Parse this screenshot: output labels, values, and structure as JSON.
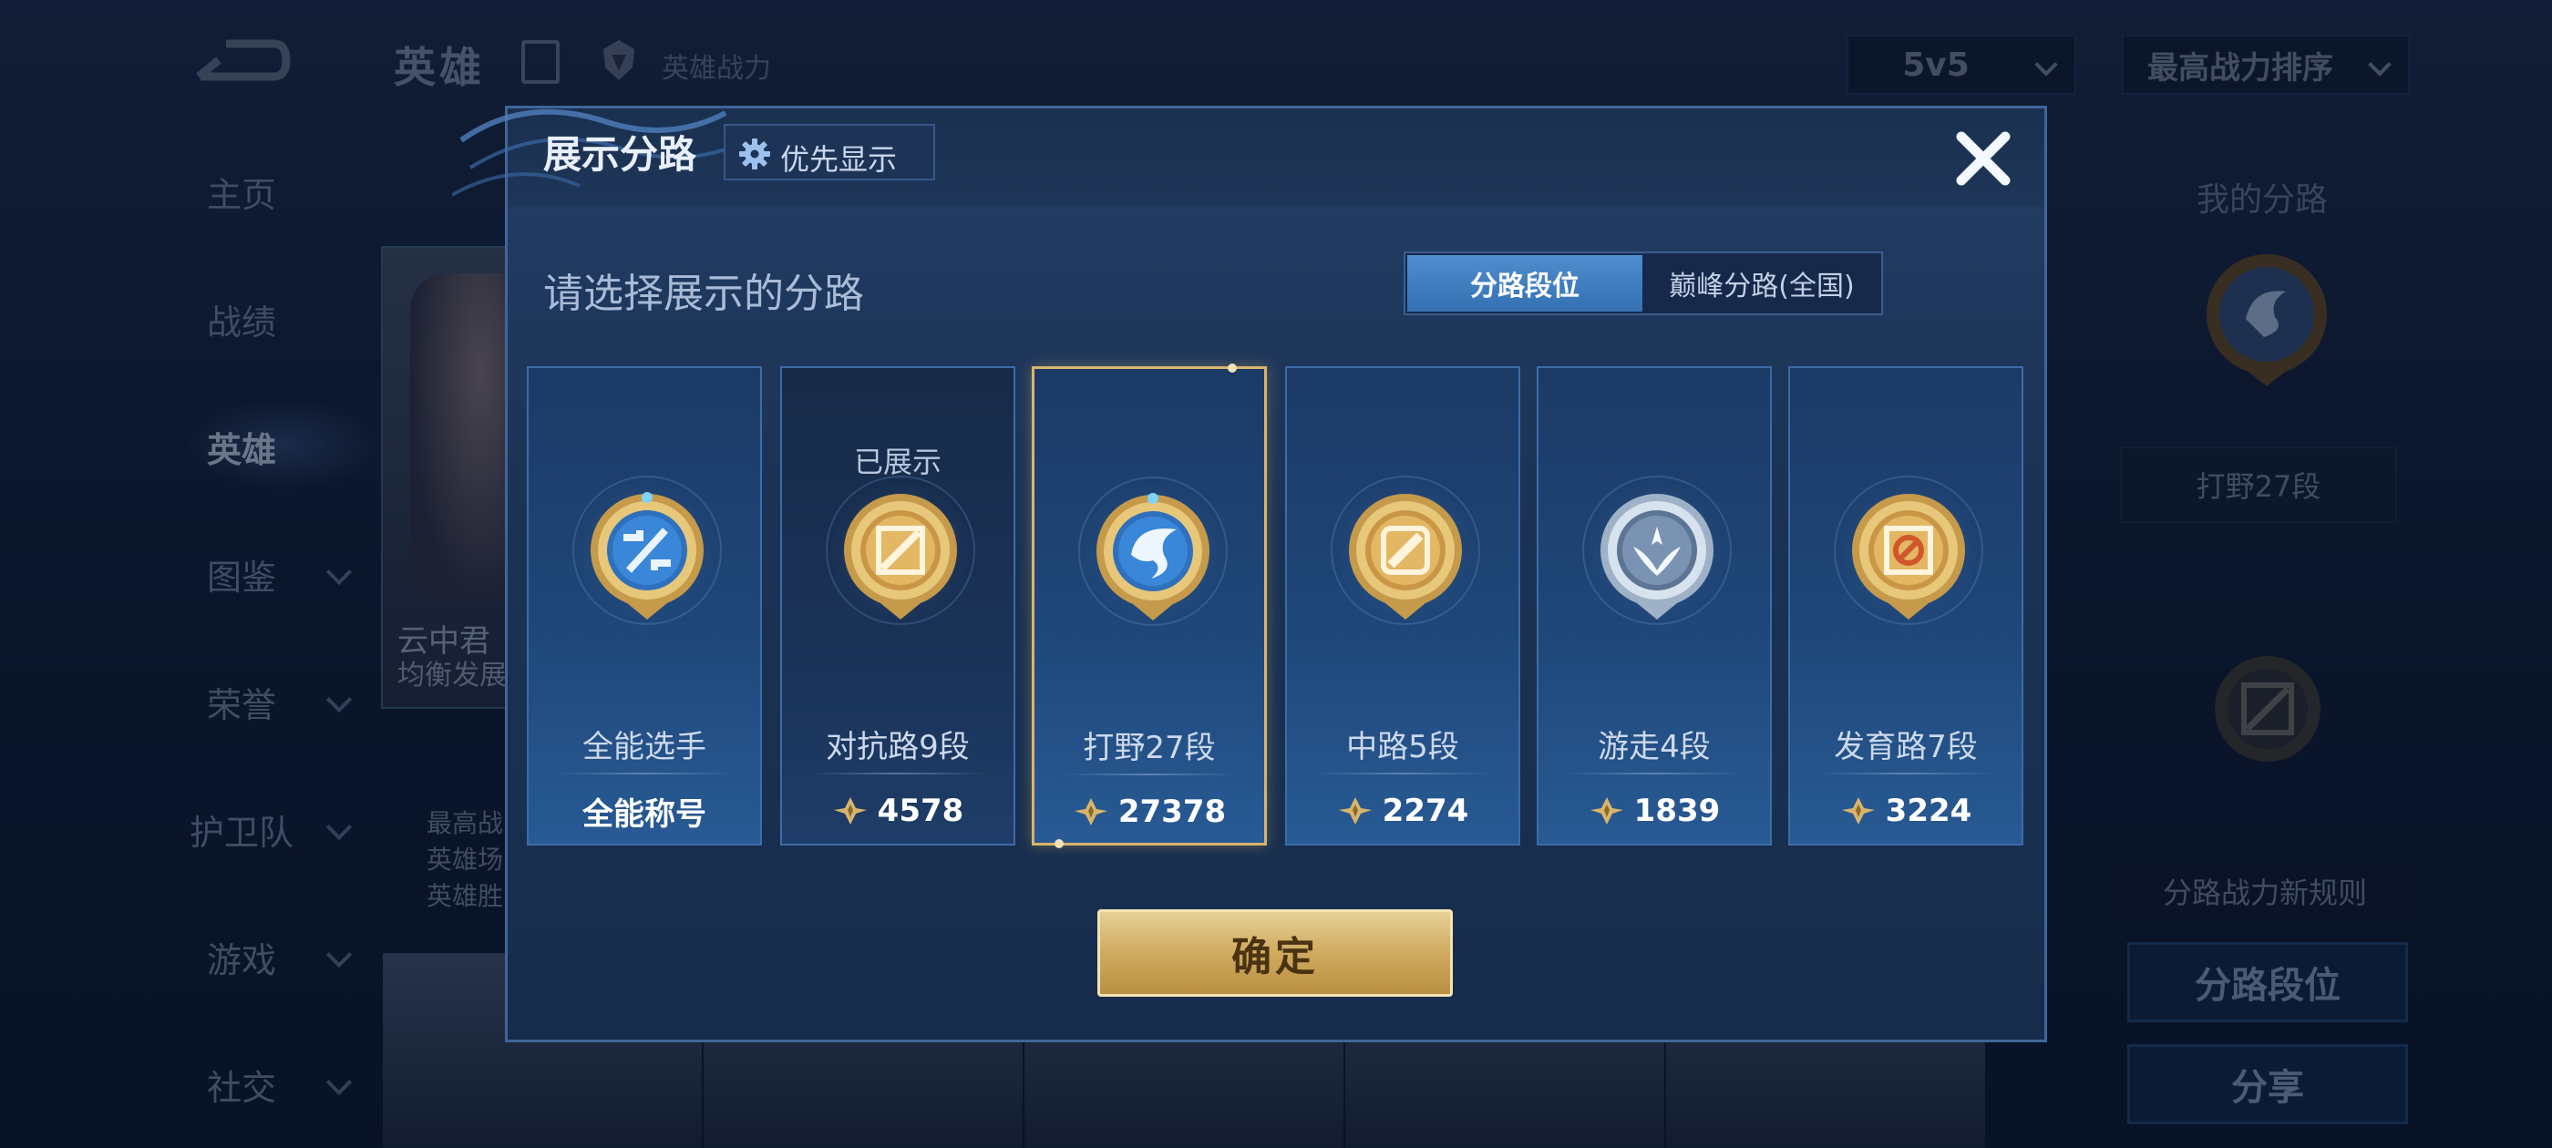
{
  "header": {
    "title": "英雄",
    "power_label": "英雄战力",
    "mode": "5v5",
    "sort": "最高战力排序"
  },
  "nav": {
    "items": [
      {
        "label": "主页",
        "has_chevron": false
      },
      {
        "label": "战绩",
        "has_chevron": false
      },
      {
        "label": "英雄",
        "has_chevron": false,
        "active": true
      },
      {
        "label": "图鉴",
        "has_chevron": true
      },
      {
        "label": "荣誉",
        "has_chevron": true
      },
      {
        "label": "护卫队",
        "has_chevron": true
      },
      {
        "label": "游戏",
        "has_chevron": true
      },
      {
        "label": "社交",
        "has_chevron": true
      }
    ]
  },
  "hero_panel": {
    "name": "云中君",
    "tag": "均衡发展",
    "stats": [
      "最高战",
      "英雄场",
      "英雄胜"
    ]
  },
  "right_panel": {
    "title": "我的分路",
    "rank": "打野27段",
    "rule": "分路战力新规则",
    "buttons": [
      "分路段位",
      "分享"
    ]
  },
  "modal": {
    "title": "展示分路",
    "priority_button": "优先显示",
    "subtitle": "请选择展示的分路",
    "tabs": [
      "分路段位",
      "巅峰分路(全国)"
    ],
    "active_tab": 0,
    "confirm": "确定",
    "cards": [
      {
        "badge": "all-round",
        "name": "全能选手",
        "value": "全能称号",
        "show_icon": false,
        "shown_label": "",
        "selected": false,
        "dark": false
      },
      {
        "badge": "clash",
        "name": "对抗路9段",
        "value": "4578",
        "show_icon": true,
        "shown_label": "已展示",
        "selected": false,
        "dark": true
      },
      {
        "badge": "jungle",
        "name": "打野27段",
        "value": "27378",
        "show_icon": true,
        "shown_label": "",
        "selected": true,
        "dark": false
      },
      {
        "badge": "mid",
        "name": "中路5段",
        "value": "2274",
        "show_icon": true,
        "shown_label": "",
        "selected": false,
        "dark": false
      },
      {
        "badge": "roam",
        "name": "游走4段",
        "value": "1839",
        "show_icon": true,
        "shown_label": "",
        "selected": false,
        "dark": false
      },
      {
        "badge": "farm",
        "name": "发育路7段",
        "value": "3224",
        "show_icon": true,
        "shown_label": "",
        "selected": false,
        "dark": false
      }
    ]
  },
  "colors": {
    "gold": "#d8b56b",
    "accent_blue": "#3f7fc4",
    "modal_bg": "#1b3355"
  }
}
